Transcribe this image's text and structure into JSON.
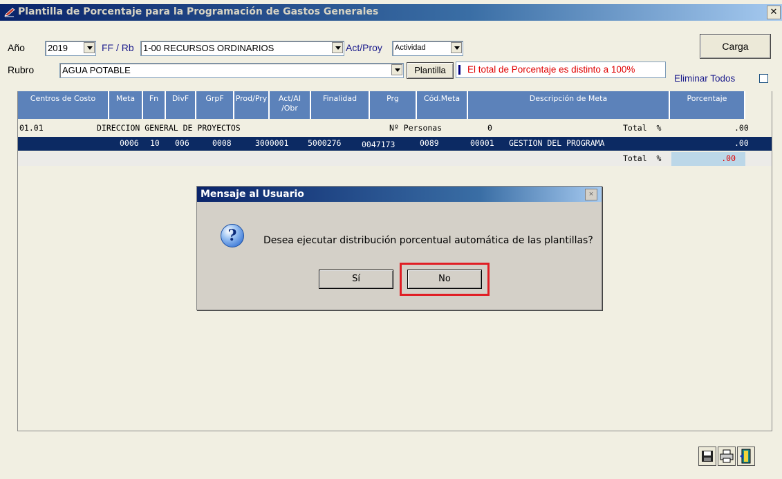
{
  "window": {
    "title": "Plantilla de Porcentaje para la Programación de Gastos Generales",
    "close_label": "✕"
  },
  "filters": {
    "anio_label": "Año",
    "anio_value": "2019",
    "ffrb_label": "FF / Rb",
    "ffrb_value": "1-00 RECURSOS ORDINARIOS",
    "actproy_label": "Act/Proy",
    "actproy_value": "Actividad",
    "rubro_label": "Rubro",
    "rubro_value": "AGUA POTABLE",
    "plantilla_label": "Plantilla",
    "warning_text": "El total de Porcentaje es distinto a 100%",
    "eliminar_label": "Eliminar Todos",
    "carga_label": "Carga"
  },
  "grid": {
    "headers": [
      "Centros de Costo",
      "Meta",
      "Fn",
      "DivF",
      "GrpF",
      "Prod/Pry",
      "Act/AI /Obr",
      "Finalidad",
      "Prg",
      "Cód.Meta",
      "Descripción de Meta",
      "Porcentaje"
    ],
    "group_row": {
      "code": "01.01",
      "name": "DIRECCION GENERAL DE PROYECTOS",
      "personas_label": "Nº Personas",
      "personas": "0",
      "total_label": "Total  %",
      "total": ".00"
    },
    "detail_row": {
      "meta": "0006",
      "fn": "10",
      "divf": "006",
      "grpf": "0008",
      "prod": "3000001",
      "act": "5000276",
      "finalidad": "0047173",
      "prg": "0089",
      "cod_meta": "00001",
      "descripcion": "GESTION DEL PROGRAMA",
      "porcentaje": ".00"
    },
    "total_row": {
      "label": "Total  %",
      "value": ".00"
    }
  },
  "dialog": {
    "title": "Mensaje al Usuario",
    "message": "Desea ejecutar distribución porcentual automática de las plantillas?",
    "yes_label": "Sí",
    "no_label": "No",
    "close_label": "×",
    "icon_glyph": "?"
  },
  "colors": {
    "accent_title": "#0a246a",
    "highlight": "#e01e24",
    "warning": "#e00000",
    "selected_row": "#0c2a63"
  }
}
